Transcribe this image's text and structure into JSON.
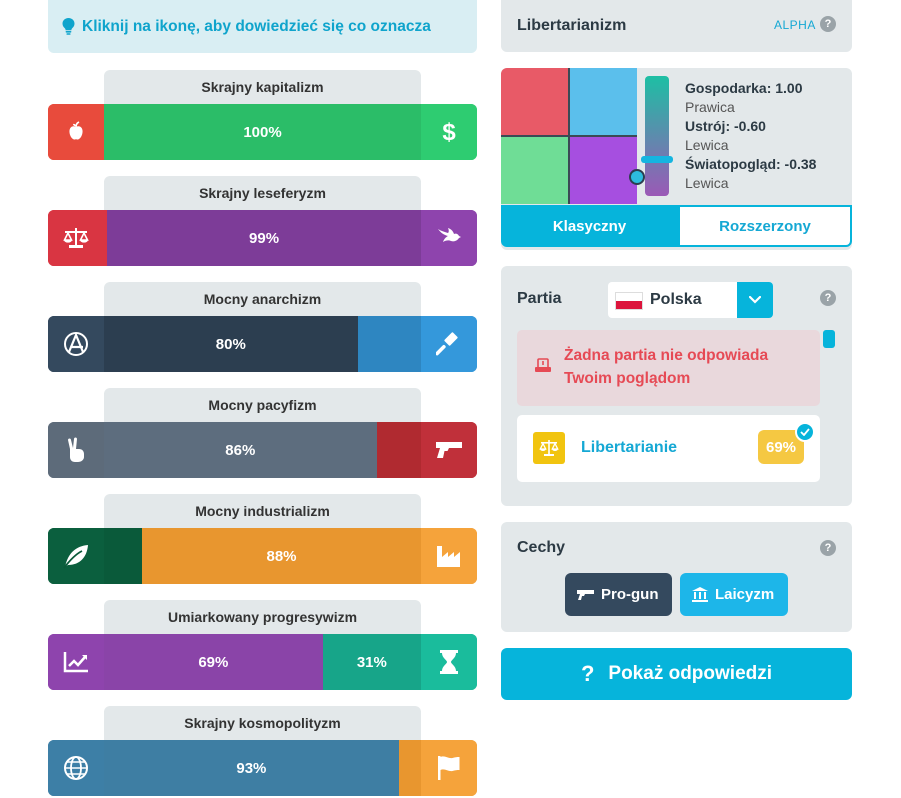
{
  "hint": {
    "text": "Kliknij na ikonę, aby dowiedzieć się co oznacza"
  },
  "axes": [
    {
      "label": "Skrajny kapitalizm",
      "left_value": 0,
      "right_value": 100,
      "left_text": "",
      "right_text": "100%",
      "left_color": "#e84b3c",
      "left_fill": "#e84b3c",
      "right_fill": "#2bbd68",
      "right_color": "#2ecc71",
      "left_icon": "apple-icon",
      "right_icon": "dollar-icon"
    },
    {
      "label": "Skrajny leseferyzm",
      "left_value": 1,
      "right_value": 99,
      "left_text": "",
      "right_text": "99%",
      "left_color": "#d93542",
      "left_fill": "#d93542",
      "right_fill": "#7d3c98",
      "right_color": "#8e44ad",
      "left_icon": "scales-icon",
      "right_icon": "dove-icon"
    },
    {
      "label": "Mocny anarchizm",
      "left_value": 80,
      "right_value": 20,
      "left_text": "80%",
      "right_text": "",
      "left_color": "#34495e",
      "left_fill": "#2c3e50",
      "right_fill": "#2e86c1",
      "right_color": "#3498db",
      "left_icon": "anarchy-icon",
      "right_icon": "gavel-icon"
    },
    {
      "label": "Mocny pacyfizm",
      "left_value": 86,
      "right_value": 14,
      "left_text": "86%",
      "right_text": "",
      "left_color": "#5d6b7a",
      "left_fill": "#5d6d7e",
      "right_fill": "#b02a30",
      "right_color": "#c0303a",
      "left_icon": "peace-hand-icon",
      "right_icon": "gun-icon"
    },
    {
      "label": "Mocny industrializm",
      "left_value": 12,
      "right_value": 88,
      "left_text": "",
      "right_text": "88%",
      "left_color": "#0b5f3e",
      "left_fill": "#0a5a3a",
      "right_fill": "#e8962f",
      "right_color": "#f5a33b",
      "left_icon": "leaf-icon",
      "right_icon": "factory-icon"
    },
    {
      "label": "Umiarkowany progresywizm",
      "left_value": 69,
      "right_value": 31,
      "left_text": "69%",
      "right_text": "31%",
      "left_color": "#8e44ad",
      "left_fill": "#8a44a8",
      "right_fill": "#17a589",
      "right_color": "#1abc9c",
      "left_icon": "chart-up-icon",
      "right_icon": "hourglass-icon"
    },
    {
      "label": "Skrajny kosmopolityzm",
      "left_value": 93,
      "right_value": 7,
      "left_text": "93%",
      "right_text": "",
      "left_color": "#3d7fa6",
      "left_fill": "#3e7ea3",
      "right_fill": "#e8962f",
      "right_color": "#f5a33b",
      "left_icon": "globe-icon",
      "right_icon": "flag-icon"
    }
  ],
  "ideology": {
    "title": "Libertarianizm",
    "badge": "ALPHA",
    "help": "?"
  },
  "coords": [
    {
      "key": "Gospodarka: 1.00",
      "value": "Prawica"
    },
    {
      "key": "Ustrój: -0.60",
      "value": "Lewica"
    },
    {
      "key": "Światopogląd: -0.38",
      "value": "Lewica"
    }
  ],
  "compass": {
    "colors": [
      "#e85a67",
      "#5bbfec",
      "#6fdd96",
      "#a64fe0"
    ],
    "slider_gradient": [
      "#1dbfa4",
      "#9b59b6"
    ]
  },
  "modes": {
    "active": "Klasyczny",
    "inactive": "Rozszerzony"
  },
  "party": {
    "title": "Partia",
    "help": "?",
    "country": "Polska",
    "alert": "Żadna partia nie odpowiada Twoim poglądom",
    "match": {
      "name": "Libertarianie",
      "score": "69%"
    }
  },
  "traits": {
    "title": "Cechy",
    "help": "?",
    "items": [
      {
        "label": "Pro-gun",
        "icon": "gun-icon",
        "color": "#34495e"
      },
      {
        "label": "Laicyzm",
        "icon": "institution-icon",
        "color": "#1db6e9"
      }
    ]
  },
  "answers_button": {
    "icon": "?",
    "label": "Pokaż odpowiedzi"
  }
}
